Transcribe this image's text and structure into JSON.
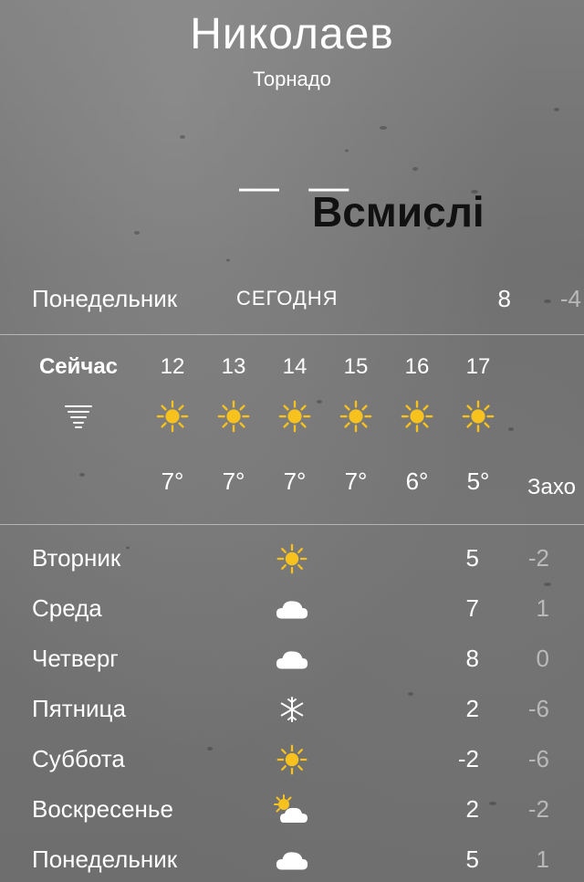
{
  "header": {
    "city": "Николаев",
    "condition": "Торнадо",
    "temperature": "— —"
  },
  "watermark": "Всмислі",
  "today": {
    "day": "Понедельник",
    "label": "СЕГОДНЯ",
    "high": "8",
    "low": "-4"
  },
  "hourly": [
    {
      "time": "Сейчас",
      "icon": "tornado-icon",
      "temp": ""
    },
    {
      "time": "12",
      "icon": "sun-icon",
      "temp": "7°"
    },
    {
      "time": "13",
      "icon": "sun-icon",
      "temp": "7°"
    },
    {
      "time": "14",
      "icon": "sun-icon",
      "temp": "7°"
    },
    {
      "time": "15",
      "icon": "sun-icon",
      "temp": "7°"
    },
    {
      "time": "16",
      "icon": "sun-icon",
      "temp": "6°"
    },
    {
      "time": "17",
      "icon": "sun-icon",
      "temp": "5°"
    }
  ],
  "hourly_extra": "Захо",
  "daily": [
    {
      "day": "Вторник",
      "icon": "sun-icon",
      "high": "5",
      "low": "-2"
    },
    {
      "day": "Среда",
      "icon": "cloud-icon",
      "high": "7",
      "low": "1"
    },
    {
      "day": "Четверг",
      "icon": "cloud-icon",
      "high": "8",
      "low": "0"
    },
    {
      "day": "Пятница",
      "icon": "snowflake-icon",
      "high": "2",
      "low": "-6"
    },
    {
      "day": "Суббота",
      "icon": "sun-icon",
      "high": "-2",
      "low": "-6"
    },
    {
      "day": "Воскресенье",
      "icon": "partly-cloudy-icon",
      "high": "2",
      "low": "-2"
    },
    {
      "day": "Понедельник",
      "icon": "cloud-icon",
      "high": "5",
      "low": "1"
    }
  ],
  "colors": {
    "sun": "#f7c21e",
    "cloud": "#ffffff",
    "lowTemp": "rgba(255,255,255,0.5)"
  }
}
